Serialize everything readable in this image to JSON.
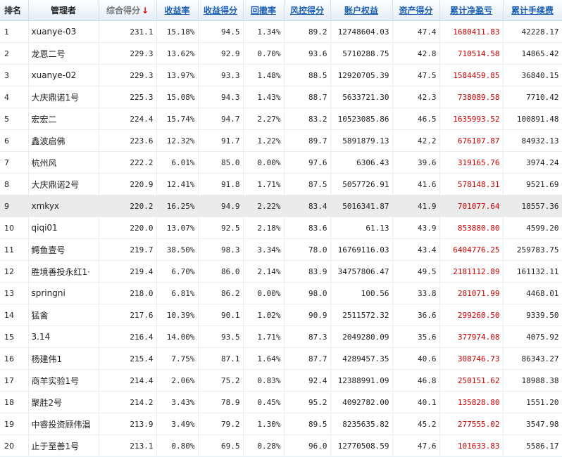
{
  "headers": [
    "排名",
    "管理者",
    "综合得分",
    "收益率",
    "收益得分",
    "回撤率",
    "风控得分",
    "账户权益",
    "资产得分",
    "累计净盈亏",
    "累计手续费"
  ],
  "rows": [
    [
      "1",
      "xuanye-03",
      "231.1",
      "15.18%",
      "94.5",
      "1.34%",
      "89.2",
      "12748604.03",
      "47.4",
      "1680411.83",
      "42228.17"
    ],
    [
      "2",
      "龙恩二号",
      "229.3",
      "13.62%",
      "92.9",
      "0.70%",
      "93.6",
      "5710288.75",
      "42.8",
      "710514.58",
      "14865.42"
    ],
    [
      "3",
      "xuanye-02",
      "229.3",
      "13.97%",
      "93.3",
      "1.48%",
      "88.5",
      "12920705.39",
      "47.5",
      "1584459.85",
      "36840.15"
    ],
    [
      "4",
      "大庆鼎诺1号",
      "225.3",
      "15.08%",
      "94.3",
      "1.43%",
      "88.7",
      "5633721.30",
      "42.3",
      "738089.58",
      "7710.42"
    ],
    [
      "5",
      "宏宏二",
      "224.4",
      "15.74%",
      "94.7",
      "2.27%",
      "83.2",
      "10523085.86",
      "46.5",
      "1635993.52",
      "100891.48"
    ],
    [
      "6",
      "鑫波启佛",
      "223.6",
      "12.32%",
      "91.7",
      "1.22%",
      "89.7",
      "5891879.13",
      "42.2",
      "676107.87",
      "84932.13"
    ],
    [
      "7",
      "杭州风",
      "222.2",
      "6.01%",
      "85.0",
      "0.00%",
      "97.6",
      "6306.43",
      "39.6",
      "319165.76",
      "3974.24"
    ],
    [
      "8",
      "大庆鼎诺2号",
      "220.9",
      "12.41%",
      "91.8",
      "1.71%",
      "87.5",
      "5057726.91",
      "41.6",
      "578148.31",
      "9521.69"
    ],
    [
      "9",
      "xmkyx",
      "220.2",
      "16.25%",
      "94.9",
      "2.22%",
      "83.4",
      "5016341.87",
      "41.9",
      "701077.64",
      "18557.36"
    ],
    [
      "10",
      "qiqi01",
      "220.0",
      "13.07%",
      "92.5",
      "2.18%",
      "83.6",
      "61.13",
      "43.9",
      "853880.80",
      "4599.20"
    ],
    [
      "11",
      "鳄鱼壹号",
      "219.7",
      "38.50%",
      "98.3",
      "3.34%",
      "78.0",
      "16769116.03",
      "43.4",
      "6404776.25",
      "259783.75"
    ],
    [
      "12",
      "胜境善投永红1·",
      "219.4",
      "6.70%",
      "86.0",
      "2.14%",
      "83.9",
      "34757806.47",
      "49.5",
      "2181112.89",
      "161132.11"
    ],
    [
      "13",
      "springni",
      "218.0",
      "6.81%",
      "86.2",
      "0.00%",
      "98.0",
      "100.56",
      "33.8",
      "281071.99",
      "4468.01"
    ],
    [
      "14",
      "猛禽",
      "217.6",
      "10.39%",
      "90.1",
      "1.02%",
      "90.9",
      "2511572.32",
      "36.6",
      "299260.50",
      "9339.50"
    ],
    [
      "15",
      "3.14",
      "216.4",
      "14.00%",
      "93.5",
      "1.71%",
      "87.3",
      "2049280.09",
      "35.6",
      "377974.08",
      "4075.92"
    ],
    [
      "16",
      "杨建伟1",
      "215.4",
      "7.75%",
      "87.1",
      "1.64%",
      "87.7",
      "4289457.35",
      "40.6",
      "308746.73",
      "86343.27"
    ],
    [
      "17",
      "商羊实验1号",
      "214.4",
      "2.06%",
      "75.2",
      "0.83%",
      "92.4",
      "12388991.09",
      "46.8",
      "250151.62",
      "18988.38"
    ],
    [
      "18",
      "聚胜2号",
      "214.2",
      "3.43%",
      "78.9",
      "0.45%",
      "95.2",
      "4092782.00",
      "40.1",
      "135828.80",
      "1551.20"
    ],
    [
      "19",
      "中睿投资顾伟淐",
      "213.9",
      "3.49%",
      "79.2",
      "1.30%",
      "89.5",
      "8235635.82",
      "45.2",
      "277555.02",
      "3547.98"
    ],
    [
      "20",
      "止于至善1号",
      "213.1",
      "0.80%",
      "69.5",
      "0.28%",
      "96.0",
      "12770508.59",
      "47.6",
      "101633.83",
      "5586.17"
    ]
  ]
}
